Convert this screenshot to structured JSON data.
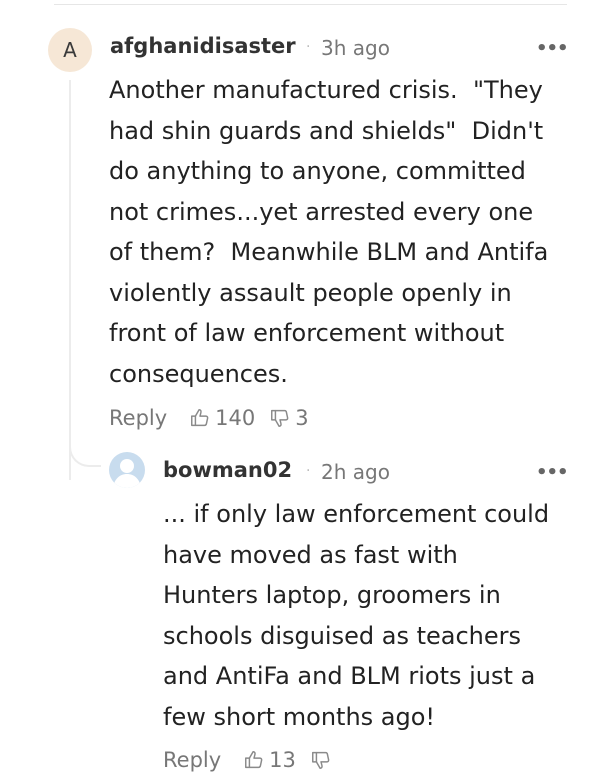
{
  "comment": {
    "avatar_letter": "A",
    "author": "afghanidisaster",
    "separator": "·",
    "time": "3h ago",
    "more": "•••",
    "lines": [
      "Another manufactured crisis.  \"They",
      "had shin guards and shields\"  Didn't",
      "do anything to anyone, committed",
      "not crimes...yet arrested every one",
      "of them?  Meanwhile BLM and Antifa",
      "violently assault people openly in",
      "front of law enforcement without",
      "consequences."
    ],
    "reply_label": "Reply",
    "likes": "140",
    "dislikes": "3"
  },
  "reply": {
    "author": "bowman02",
    "separator": "·",
    "time": "2h ago",
    "more": "•••",
    "lines": [
      "... if only law enforcement could",
      "have moved as fast with",
      "Hunters laptop, groomers in",
      "schools disguised as teachers",
      "and AntiFa and BLM riots just a",
      "few short months ago!"
    ],
    "reply_label": "Reply",
    "likes": "13",
    "dislikes": ""
  },
  "colors": {
    "avatar_bg": "#f6e7d6",
    "user_avatar_bg": "#c8dcee",
    "meta_text": "#777777",
    "divider": "#e6e6e6"
  }
}
